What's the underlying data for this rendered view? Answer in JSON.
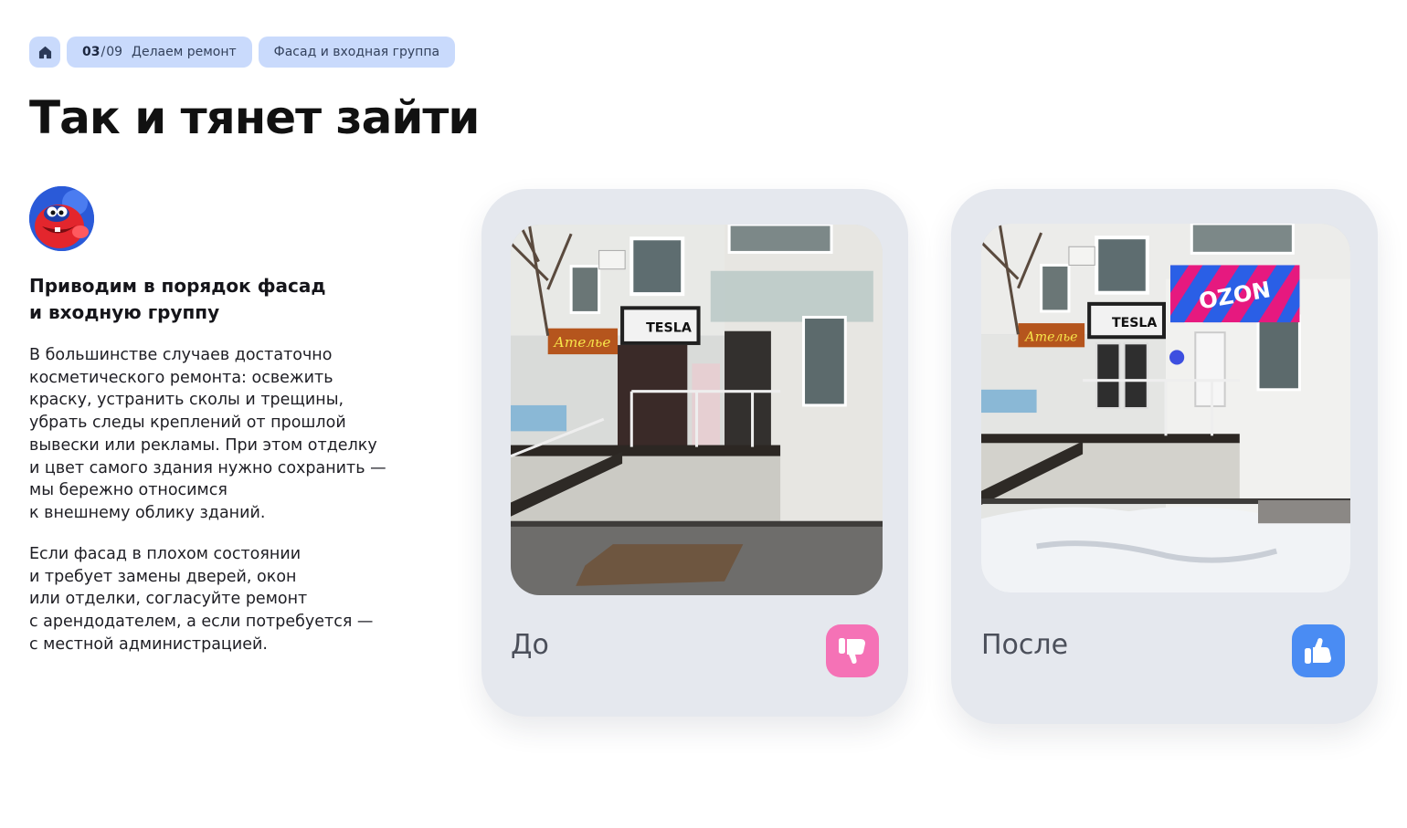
{
  "breadcrumbs": {
    "step_current": "03",
    "step_sep": "/",
    "step_total": "09",
    "step_label": "Делаем ремонт",
    "section": "Фасад и входная группа"
  },
  "title": "Так и тянет зайти",
  "subheading": "Приводим в порядок фасад\nи входную группу",
  "paragraph1": "В большинстве случаев достаточно\nкосметического ремонта: освежить\nкраску, устранить сколы и трещины,\nубрать следы креплений от прошлой\nвывески или рекламы. При этом отделку\nи цвет самого здания нужно сохранить —\nмы бережно относимся\nк внешнему облику зданий.",
  "paragraph2": "Если фасад в плохом состоянии\nи требует замены дверей, окон\nили отделки, согласуйте ремонт\nс арендодателем, а если потребуется —\nс местной администрацией.",
  "cards": {
    "before": {
      "label": "До",
      "icon": "thumbs-down-icon",
      "icon_color": "#f572b6"
    },
    "after": {
      "label": "После",
      "icon": "thumbs-up-icon",
      "icon_color": "#4a8cf3"
    }
  },
  "photo_signs": {
    "atelier": "Ателье",
    "tesla": "TESLA",
    "ozon": "OZON"
  },
  "colors": {
    "crumb_bg": "#c9dafc",
    "card_bg": "#e5e8ee",
    "ozon_pink": "#e6197f",
    "ozon_blue": "#2a5fe6"
  }
}
